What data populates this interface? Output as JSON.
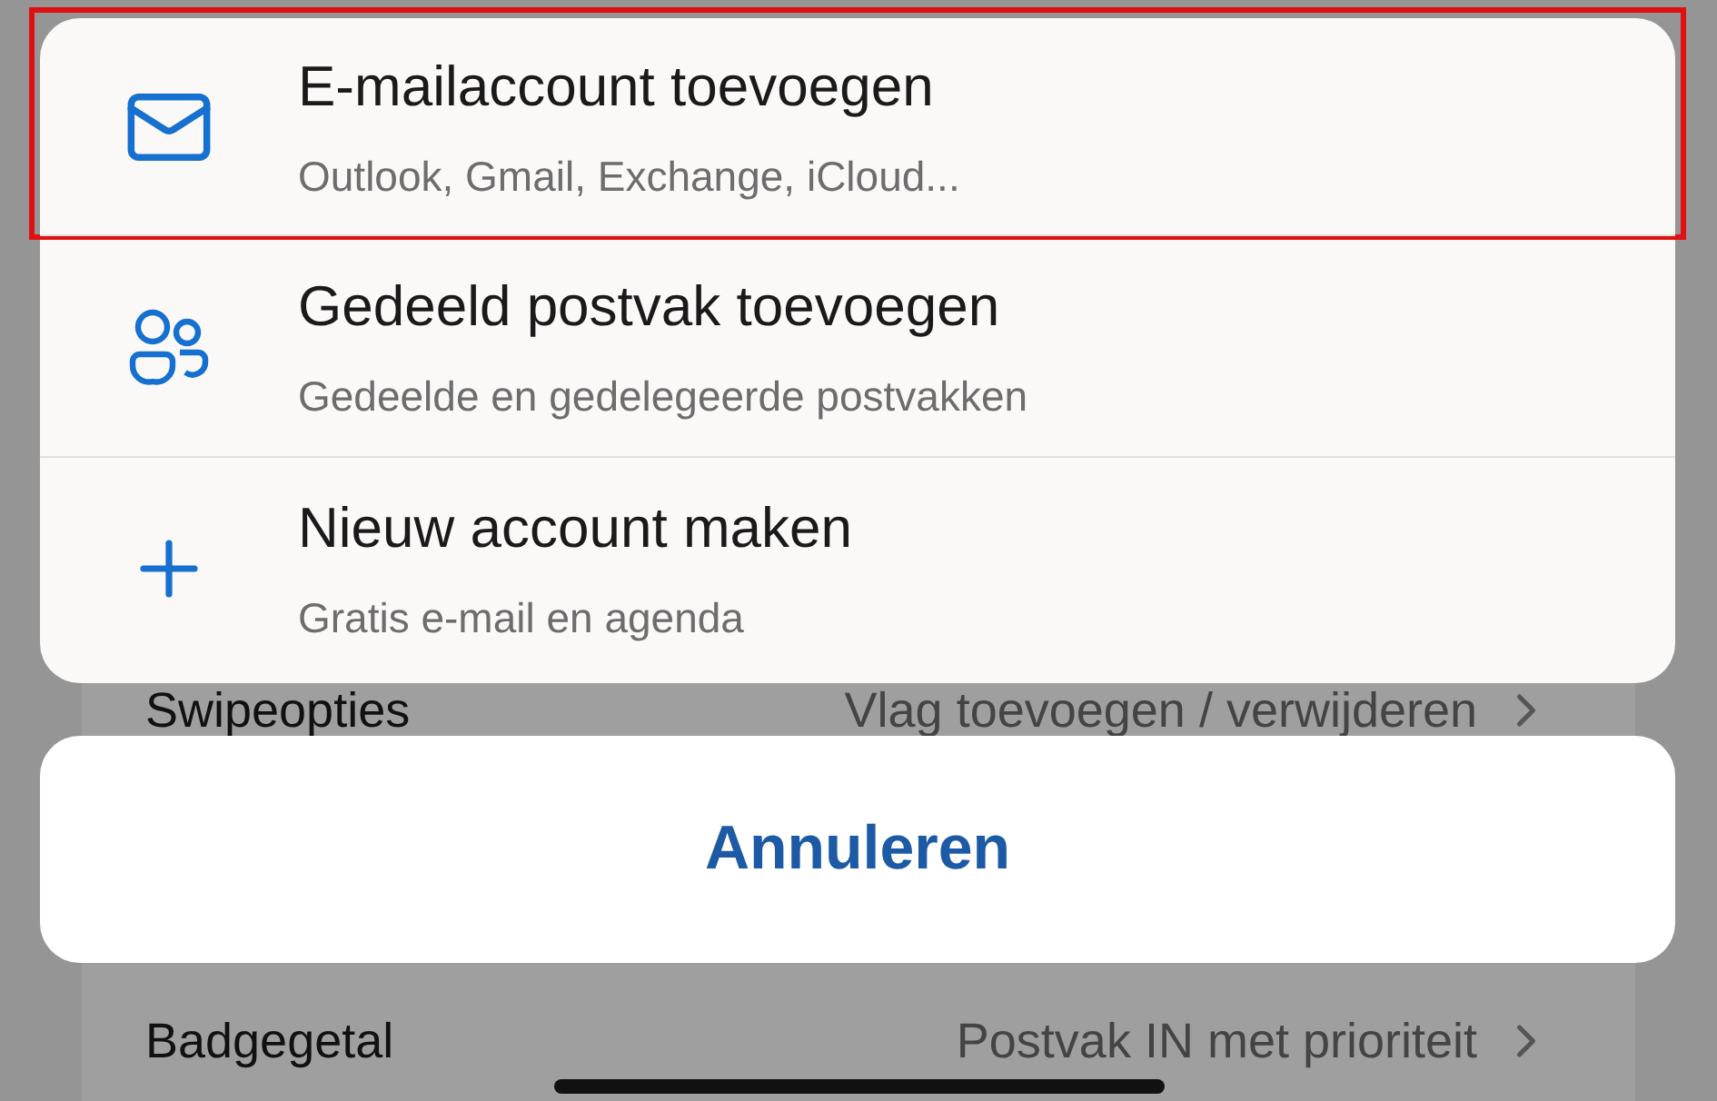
{
  "background_settings": {
    "rows": [
      {
        "label": "Swipeopties",
        "value": "Vlag toevoegen / verwijderen"
      },
      {
        "label": "Badgegetal",
        "value": "Postvak IN met prioriteit"
      }
    ]
  },
  "menu": {
    "items": [
      {
        "title": "E-mailaccount toevoegen",
        "subtitle": "Outlook, Gmail, Exchange, iCloud...",
        "highlighted": true
      },
      {
        "title": "Gedeeld postvak toevoegen",
        "subtitle": "Gedeelde en gedelegeerde postvakken",
        "highlighted": false
      },
      {
        "title": "Nieuw account maken",
        "subtitle": "Gratis e-mail en agenda",
        "highlighted": false
      }
    ]
  },
  "cancel_button": {
    "label": "Annuleren"
  }
}
